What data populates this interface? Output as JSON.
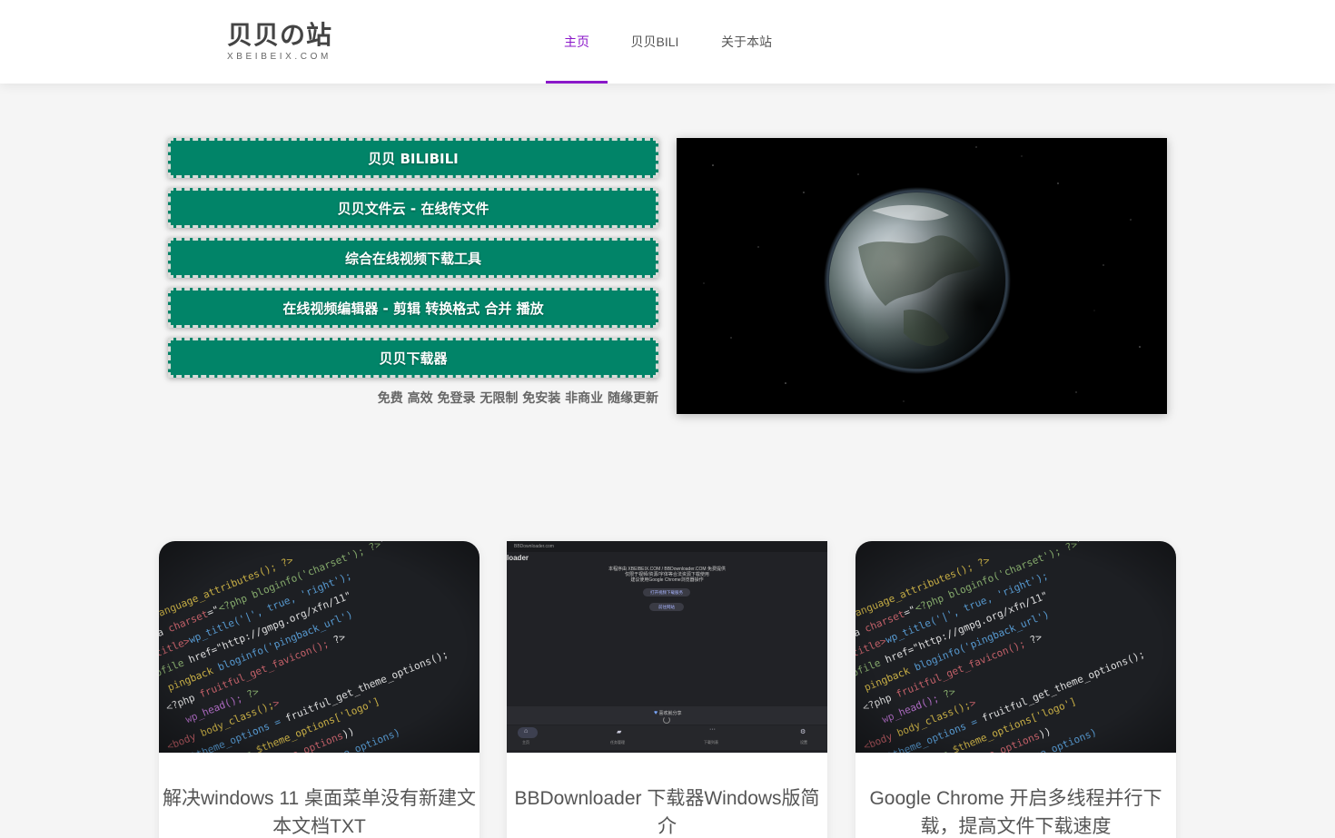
{
  "site": {
    "title": "贝贝の站",
    "subtitle": "XBEIBEIX.COM"
  },
  "nav": {
    "items": [
      {
        "label": "主页",
        "active": true
      },
      {
        "label": "贝贝BILI",
        "active": false
      },
      {
        "label": "关于本站",
        "active": false
      }
    ],
    "accent_color": "#8a17c9"
  },
  "hero": {
    "buttons": [
      {
        "label": "贝贝 BILIBILI"
      },
      {
        "label": "贝贝文件云 - 在线传文件"
      },
      {
        "label": "综合在线视频下载工具"
      },
      {
        "label": "在线视频编辑器 - 剪辑 转换格式 合并 播放"
      },
      {
        "label": "贝贝下载器"
      }
    ],
    "button_color": "#018468",
    "tagline": "免费 高效 免登录 无限制 免安装 非商业 随缘更新"
  },
  "cards": [
    {
      "title": "解决windows 11 桌面菜单没有新建文本文档TXT",
      "image": "code-screen-image"
    },
    {
      "title": "BBDownloader 下载器Windows版简介",
      "image": "app-screenshot-image",
      "screenshot_text": {
        "window_title": "BBDownloader.com",
        "app_name": "loader",
        "line1": "本程序由 XBEIBEIX.COM / BBDownloader.COM 免费提供",
        "line2": "仅限于视频/资源/字体等合法资源下载使用",
        "line3": "建议使用Google Chrome浏览器操作",
        "btn1": "打开视频下载服务",
        "btn2": "前往网站",
        "footer": "喜欢就分享",
        "tabs": [
          "主页",
          "任务管理",
          "下载列表",
          "设置"
        ]
      }
    },
    {
      "title": "Google Chrome 开启多线程并行下载，提高文件下载速度",
      "image": "code-screen-image"
    }
  ]
}
